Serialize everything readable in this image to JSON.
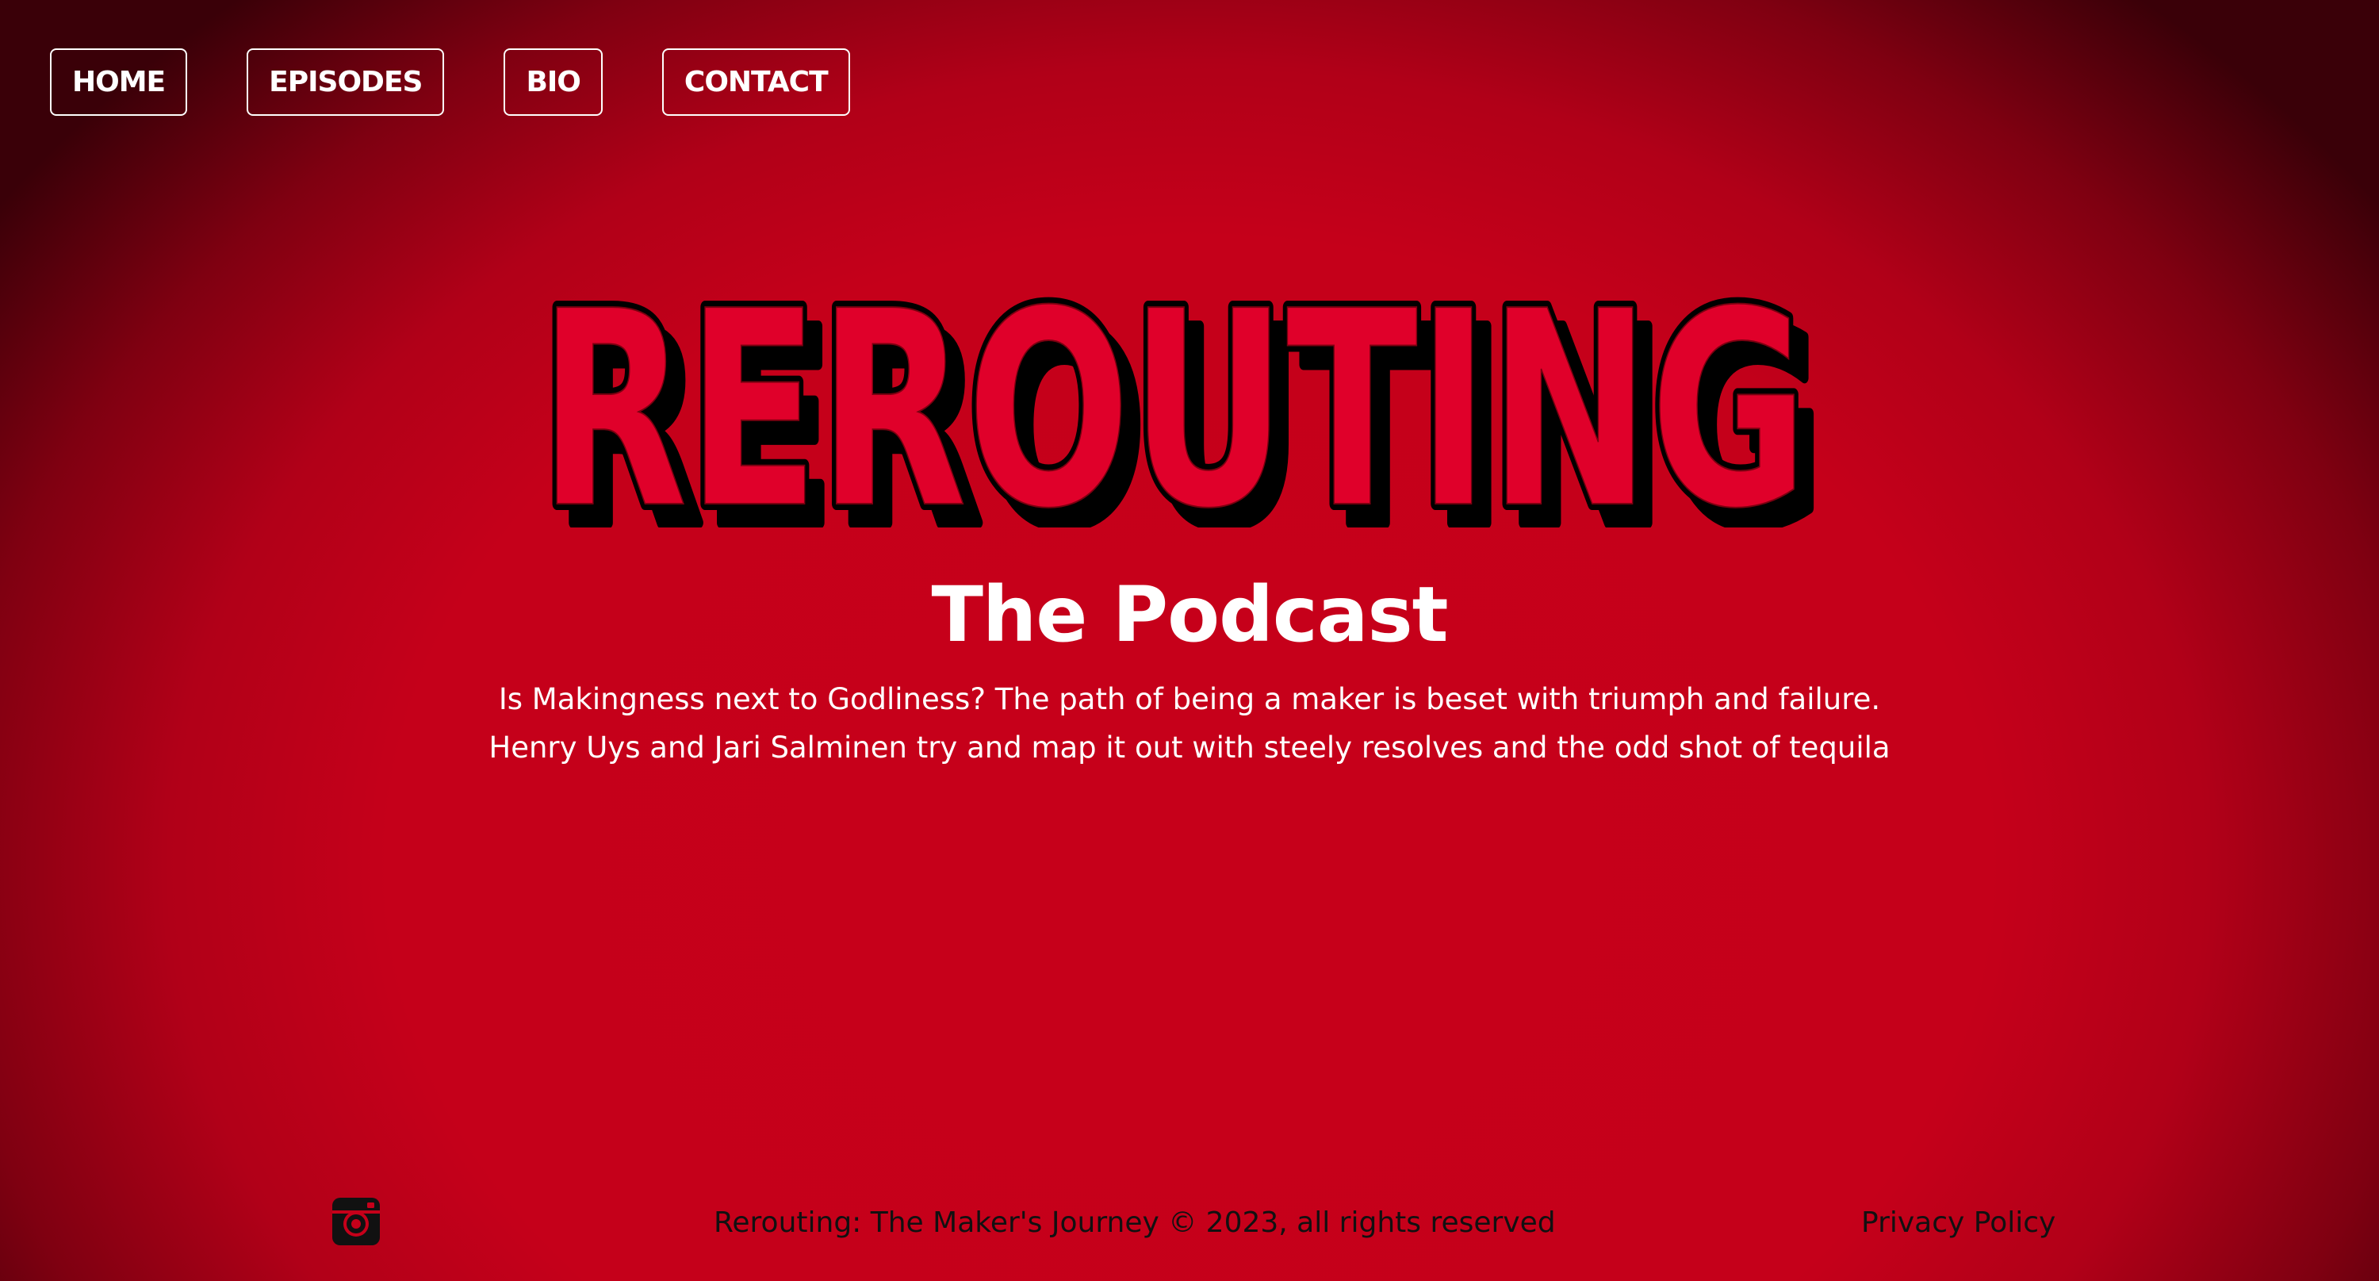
{
  "nav": {
    "items": [
      {
        "label": "HOME"
      },
      {
        "label": "EPISODES"
      },
      {
        "label": "BIO"
      },
      {
        "label": "CONTACT"
      }
    ]
  },
  "hero": {
    "logo_text": "REROUTING",
    "subtitle": "The Podcast",
    "description": "Is Makingness next to Godliness? The path of being a maker is beset with triumph and failure. Henry Uys and Jari Salminen try and map it out with steely resolves and the odd shot of tequila"
  },
  "footer": {
    "social_icon": "instagram-icon",
    "copyright": "Rerouting: The Maker's Journey © 2023, all rights reserved",
    "privacy_label": "Privacy Policy"
  },
  "colors": {
    "background_center": "#c6001a",
    "background_edge": "#3a0008",
    "logo_fill": "#e0002a",
    "logo_shadow": "#000000",
    "text_primary": "#ffffff",
    "footer_text": "#111111"
  }
}
